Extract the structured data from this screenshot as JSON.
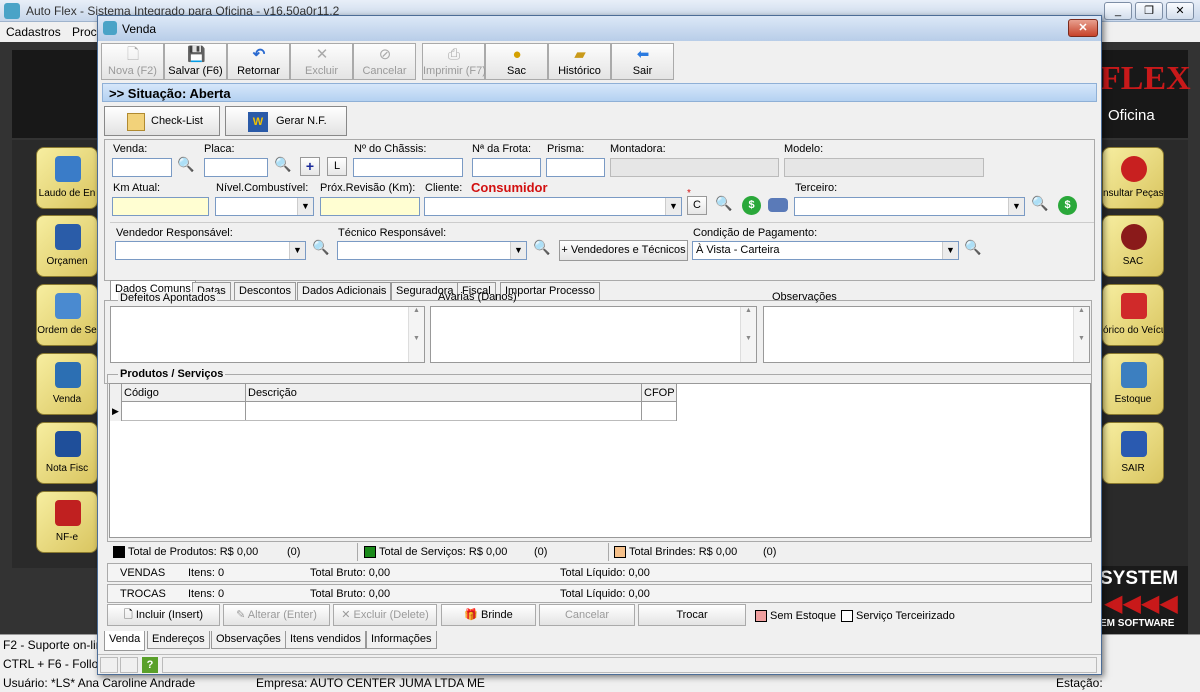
{
  "app": {
    "title": "Auto Flex - Sistema Integrado para Oficina - v16.50a0r11.2",
    "menu": [
      "Cadastros",
      "Proc"
    ],
    "logo_text": "FLEX",
    "logo_sub": "Oficina",
    "brand": "SYSTEM",
    "brand_sub": "EM SOFTWARE"
  },
  "sidebar_left": [
    "Laudo de En",
    "Orçamen",
    "Ordem de Se",
    "Venda",
    "Nota Fisc",
    "NF-e"
  ],
  "sidebar_right": [
    "nsultar Peças",
    "SAC",
    "órico do Veículo",
    "Estoque",
    "SAIR"
  ],
  "statusbar": {
    "f2": "F2 - Suporte on-lin",
    "ctrl": "CTRL + F6 - Follo",
    "user": "Usuário: *LS* Ana Caroline Andrade",
    "empresa": "Empresa: AUTO CENTER JUMA LTDA ME",
    "estacao": "Estação:"
  },
  "dialog": {
    "title": "Venda",
    "situacao": ">> Situação: Aberta"
  },
  "toolbar": [
    {
      "label": "Nova (F2)",
      "icon": "new-doc-icon",
      "enabled": false
    },
    {
      "label": "Salvar (F6)",
      "icon": "save-icon",
      "enabled": true
    },
    {
      "label": "Retornar",
      "icon": "undo-icon",
      "enabled": true
    },
    {
      "label": "Excluir",
      "icon": "delete-icon",
      "enabled": false
    },
    {
      "label": "Cancelar",
      "icon": "cancel-icon",
      "enabled": false
    },
    {
      "label": "Imprimir (F7)",
      "icon": "print-icon",
      "enabled": false
    },
    {
      "label": "Sac",
      "icon": "user-icon",
      "enabled": true
    },
    {
      "label": "Histórico",
      "icon": "folder-icon",
      "enabled": true
    },
    {
      "label": "Sair",
      "icon": "exit-icon",
      "enabled": true
    }
  ],
  "actions": {
    "checklist": "Check-List",
    "gerar_nf": "Gerar N.F."
  },
  "fields": {
    "venda": "Venda:",
    "placa": "Placa:",
    "chassis": "Nº do Chãssis:",
    "frota": "Nª da Frota:",
    "prisma": "Prisma:",
    "montadora": "Montadora:",
    "modelo": "Modelo:",
    "km": "Km Atual:",
    "combustivel": "Nível.Combustível:",
    "revisao": "Próx.Revisão (Km):",
    "cliente": "Cliente:",
    "cliente_value": "Consumidor",
    "terceiro": "Terceiro:",
    "vendedor": "Vendedor Responsável:",
    "tecnico": "Técnico Responsável:",
    "vendedores_btn": "+ Vendedores e Técnicos",
    "pagamento": "Condição de Pagamento:",
    "pagamento_value": "À Vista - Carteira",
    "plus": "+",
    "l": "L",
    "c": "C"
  },
  "tabs": [
    "Dados Comuns",
    "Datas",
    "Descontos",
    "Dados Adicionais",
    "Seguradora",
    "Fiscal",
    "Importar Processo"
  ],
  "memos": {
    "defeitos": "Defeitos Apontados",
    "avarias": "Avarias (Danos)",
    "observacoes": "Observações"
  },
  "produtos": {
    "title": "Produtos / Serviços",
    "columns": [
      "Código",
      "Descrição",
      "CFOP"
    ]
  },
  "totals": {
    "produtos": "Total de Produtos: R$ 0,00",
    "produtos_count": "(0)",
    "servicos": "Total de Serviços: R$ 0,00",
    "servicos_count": "(0)",
    "brindes": "Total Brindes: R$ 0,00",
    "brindes_count": "(0)"
  },
  "summary": [
    {
      "label": "VENDAS",
      "itens": "Itens: 0",
      "bruto": "Total Bruto: 0,00",
      "liquido": "Total Líquido: 0,00"
    },
    {
      "label": "TROCAS",
      "itens": "Itens: 0",
      "bruto": "Total Bruto: 0,00",
      "liquido": "Total Líquido: 0,00"
    }
  ],
  "bottom_buttons": {
    "incluir": "Incluir (Insert)",
    "alterar": "Alterar (Enter)",
    "excluir": "Excluir (Delete)",
    "brinde": "Brinde",
    "cancelar": "Cancelar",
    "trocar": "Trocar",
    "sem_estoque": "Sem Estoque",
    "terceirizado": "Serviço Terceirizado"
  },
  "bottom_tabs": [
    "Venda",
    "Endereços",
    "Observações",
    "Itens vendidos",
    "Informações"
  ],
  "colors": {
    "produtos": "#000000",
    "servicos": "#1a8a1a",
    "brindes": "#f5c08a",
    "sem_estoque": "#f0a0a0"
  }
}
